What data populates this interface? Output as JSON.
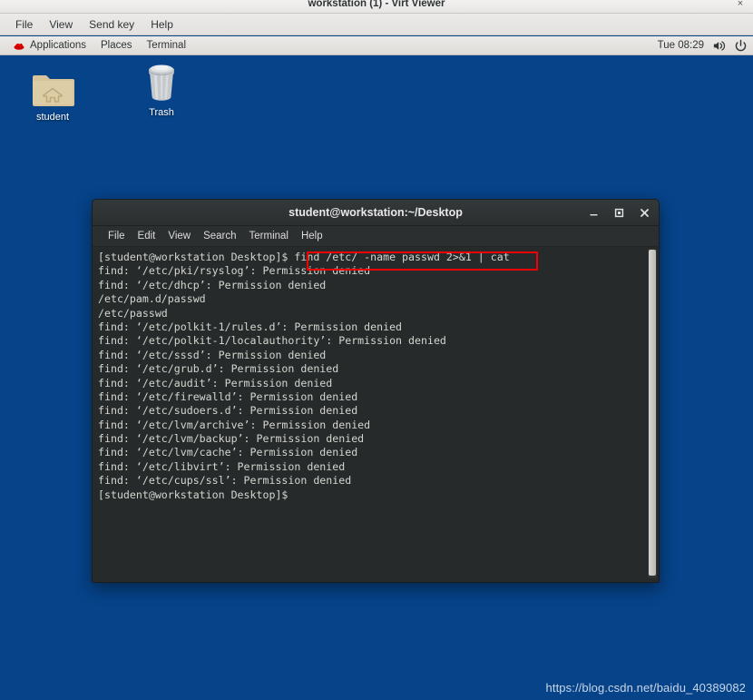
{
  "viewer": {
    "title": "workstation (1) - Virt Viewer",
    "close_label": "×",
    "menu": [
      "File",
      "View",
      "Send key",
      "Help"
    ]
  },
  "panel": {
    "logo_name": "redhat-logo",
    "items": [
      "Applications",
      "Places",
      "Terminal"
    ],
    "clock": "Tue 08:29",
    "volume_icon": "volume-icon",
    "power_icon": "power-icon"
  },
  "desktop": {
    "background_color": "#064389",
    "icons": [
      {
        "label": "student",
        "icon": "home-folder-icon"
      },
      {
        "label": "Trash",
        "icon": "trash-icon"
      }
    ]
  },
  "terminal": {
    "title": "student@workstation:~/Desktop",
    "menu": [
      "File",
      "Edit",
      "View",
      "Search",
      "Terminal",
      "Help"
    ],
    "buttons": {
      "minimize": "–",
      "maximize": "□",
      "close": "×"
    },
    "prompt": "[student@workstation Desktop]$ ",
    "command": "find /etc/ -name passwd 2>&1 | cat",
    "highlight_color": "#f40000",
    "lines": [
      "[student@workstation Desktop]$ find /etc/ -name passwd 2>&1 | cat",
      "find: ‘/etc/pki/rsyslog’: Permission denied",
      "find: ‘/etc/dhcp’: Permission denied",
      "/etc/pam.d/passwd",
      "/etc/passwd",
      "find: ‘/etc/polkit-1/rules.d’: Permission denied",
      "find: ‘/etc/polkit-1/localauthority’: Permission denied",
      "find: ‘/etc/sssd’: Permission denied",
      "find: ‘/etc/grub.d’: Permission denied",
      "find: ‘/etc/audit’: Permission denied",
      "find: ‘/etc/firewalld’: Permission denied",
      "find: ‘/etc/sudoers.d’: Permission denied",
      "find: ‘/etc/lvm/archive’: Permission denied",
      "find: ‘/etc/lvm/backup’: Permission denied",
      "find: ‘/etc/lvm/cache’: Permission denied",
      "find: ‘/etc/libvirt’: Permission denied",
      "find: ‘/etc/cups/ssl’: Permission denied",
      "[student@workstation Desktop]$"
    ]
  },
  "watermark": "https://blog.csdn.net/baidu_40389082"
}
